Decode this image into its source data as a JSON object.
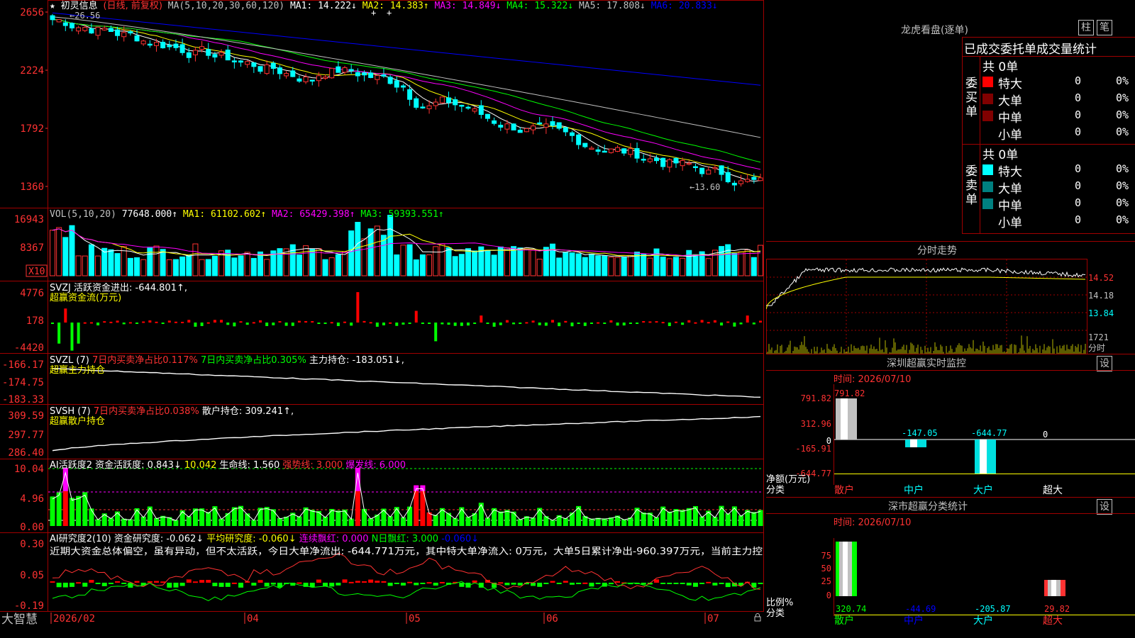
{
  "colors": {
    "up": "#ff3232",
    "down": "#00ffff",
    "ma1": "#ffffff",
    "ma2": "#ffff00",
    "ma3": "#ff00ff",
    "ma4": "#00ff00",
    "ma5": "#c0c0c0",
    "ma6": "#0000ff",
    "axis": "#ff3232",
    "grid": "#a00000"
  },
  "header": {
    "star": "★",
    "stock_name": "初灵信息",
    "mode": "(日线, 前复权)",
    "ma_label": "MA(5,10,20,30,60,120)",
    "ma1": "MA1: 14.222↓",
    "ma2": "MA2: 14.383↑",
    "ma3": "MA3: 14.849↓",
    "ma4": "MA4: 15.322↓",
    "ma5": "MA5: 17.808↓",
    "ma6": "MA6: 20.833↓",
    "high_label": "←26.56",
    "low_label": "←13.60"
  },
  "price_axis": [
    "2656",
    "2224",
    "1792",
    "1360"
  ],
  "vol": {
    "title": "VOL(5,10,20)",
    "value": "77648.000↑",
    "ma1": "MA1: 61102.602↑",
    "ma2": "MA2: 65429.398↑",
    "ma3": "MA3: 59393.551↑",
    "axis": [
      "16943",
      "8367"
    ],
    "unit": "X10"
  },
  "svzj": {
    "title": "SVZJ  活跃资金进出: -644.801↑,",
    "subtitle": "超赢资金流(万元)",
    "axis": [
      "4776",
      "178",
      "-4420"
    ]
  },
  "svzl": {
    "title": "SVZL (7)",
    "t1": "7日内买卖净占比0.117%",
    "t2": "7日内买卖净占比0.305%",
    "t3": "主力持仓: -183.051↓,",
    "subtitle": "超赢主力持仓",
    "axis": [
      "-166.17",
      "-174.75",
      "-183.33"
    ]
  },
  "svsh": {
    "title": "SVSH (7)",
    "t1": "7日内买卖净占比0.038%",
    "t2": "散户持仓: 309.241↑,",
    "subtitle": "超赢散户持仓",
    "axis": [
      "309.59",
      "297.77",
      "286.40"
    ]
  },
  "ai1": {
    "title": "AI活跃度2",
    "t1": "资金活跃度: 0.843↓",
    "t2": "10.042",
    "t3": "生命线: 1.560",
    "t4": "强势线: 3.000",
    "t5": "爆发线: 6.000",
    "axis": [
      "10.04",
      "4.96",
      "0.00"
    ]
  },
  "ai2": {
    "title": "AI研究度2(10)",
    "t1": "资金研究度: -0.062↓",
    "t2": "平均研究度: -0.060↓",
    "t3": "连续飘红: 0.000",
    "t4": "N日飘红: 3.000",
    "t5": "-0.060↓",
    "axis": [
      "0.30",
      "0.05",
      "-0.19"
    ],
    "comment": "近期大资金总体偏空，虽有异动，但不太活跃，今日大单净流出: -644.771万元，其中特大单净流入: 0万元，大单5日累计净出-960.397万元，当前主力控"
  },
  "bottom": {
    "brand": "大智慧",
    "dates": [
      "2026/02",
      "04",
      "05",
      "06",
      "07"
    ]
  },
  "lhb": {
    "title": "龙虎看盘(逐单)",
    "btn1": "柱",
    "btn2": "笔",
    "subtitle": "已成交委托单成交量统计",
    "buy_label": [
      "委",
      "买",
      "单"
    ],
    "sell_label": [
      "委",
      "卖",
      "单"
    ],
    "buy_total": "共 0单",
    "sell_total": "共 0单",
    "buy_rows": [
      {
        "name": "特大",
        "v": "0",
        "p": "0%",
        "c": "#ff0000"
      },
      {
        "name": "大单",
        "v": "0",
        "p": "0%",
        "c": "#800000"
      },
      {
        "name": "中单",
        "v": "0",
        "p": "0%",
        "c": "#800000"
      },
      {
        "name": "小单",
        "v": "0",
        "p": "0%",
        "c": "#000000"
      }
    ],
    "sell_rows": [
      {
        "name": "特大",
        "v": "0",
        "p": "0%",
        "c": "#00ffff"
      },
      {
        "name": "大单",
        "v": "0",
        "p": "0%",
        "c": "#008080"
      },
      {
        "name": "中单",
        "v": "0",
        "p": "0%",
        "c": "#008080"
      },
      {
        "name": "小单",
        "v": "0",
        "p": "0%",
        "c": "#000000"
      }
    ]
  },
  "intraday": {
    "title": "分时走势",
    "axis": [
      "14.52",
      "14.18",
      "13.84"
    ],
    "vol_axis": [
      "1721",
      "分时"
    ]
  },
  "sz_monitor": {
    "title": "深圳超赢实时监控",
    "btn": "设",
    "date": "时间: 2026/07/10",
    "axis": [
      "791.82",
      "312.96",
      "0",
      "-165.91",
      "-644.77"
    ],
    "values": [
      "791.82",
      "-147.05",
      "-644.77",
      "0"
    ],
    "unit": "净额(万元)",
    "cls": "分类",
    "cats": [
      "散户",
      "中户",
      "大户",
      "超大"
    ]
  },
  "sz_stat": {
    "title": "深市超赢分类统计",
    "btn": "设",
    "date": "时间: 2026/07/10",
    "axis": [
      "75",
      "50",
      "25",
      "0"
    ],
    "values": [
      "320.74",
      "-44.69",
      "-205.87",
      "29.82"
    ],
    "unit": "比例%",
    "cls": "分类",
    "cats": [
      "散户",
      "中户",
      "大户",
      "超大"
    ]
  }
}
